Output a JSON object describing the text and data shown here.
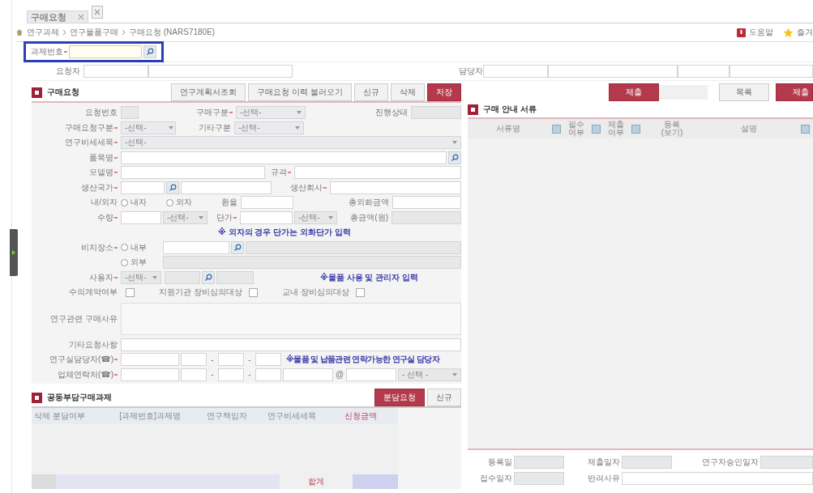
{
  "tabs": [
    {
      "label": "구매요청",
      "selected": true
    }
  ],
  "breadcrumb": [
    "연구과제",
    "연구물품구매",
    "구매요청 (NARS7180E)"
  ],
  "header_links": [
    {
      "label": "도움말",
      "kind": "help"
    },
    {
      "label": "즐겨",
      "kind": "favorite"
    }
  ],
  "project_no": {
    "label": "과제번호",
    "required": true,
    "highlighted": true
  },
  "requester": {
    "label": "요청자"
  },
  "manager": {
    "label": "담당자"
  },
  "request_section": {
    "title": "구매요청",
    "buttons": [
      {
        "label": "연구계획서조회",
        "kind": "normal"
      },
      {
        "label": "구매요청 이력 불러오기",
        "kind": "normal"
      },
      {
        "label": "신규",
        "kind": "normal"
      },
      {
        "label": "삭제",
        "kind": "normal"
      },
      {
        "label": "저장",
        "kind": "primary"
      }
    ]
  },
  "form": {
    "request_no": {
      "label": "요청번호"
    },
    "purchase_type": {
      "label": "구매구분",
      "required": true,
      "value": "-선택-"
    },
    "status": {
      "label": "진행상태"
    },
    "request_type": {
      "label": "구매요청구분",
      "required": true,
      "value": "-선택-"
    },
    "other_type": {
      "label": "기타구분",
      "value": "-선택-"
    },
    "budget_item": {
      "label": "연구비세세목",
      "required": true,
      "value": "-선택-"
    },
    "item_name": {
      "label": "품목명",
      "required": true
    },
    "model": {
      "label": "모델명",
      "required": true
    },
    "spec": {
      "label": "규격",
      "required": true
    },
    "country": {
      "label": "생산국가",
      "required": true
    },
    "maker": {
      "label": "생산회사",
      "required": true
    },
    "currency": {
      "label": "내/외자",
      "options": [
        {
          "label": "내자",
          "selected": false
        },
        {
          "label": "외자",
          "selected": false
        }
      ]
    },
    "exchange_rate": {
      "label": "환율"
    },
    "foreign_total": {
      "label": "총외화금액"
    },
    "quantity": {
      "label": "수량",
      "required": true,
      "unit": "-선택-"
    },
    "unit_price": {
      "label": "단가",
      "required": true,
      "unit": "-선택-"
    },
    "total_won": {
      "label": "총금액(원)"
    },
    "currency_note": "※ 외자의 경우 단가는 외화단가 입력",
    "location": {
      "label": "비치장소",
      "required": true,
      "options": [
        {
          "label": "내부",
          "selected": false
        },
        {
          "label": "외부",
          "selected": false
        }
      ]
    },
    "user": {
      "label": "사용자",
      "required": true,
      "value": "-선택-"
    },
    "user_note": "※물품 사용 및 관리자 입력",
    "checks": [
      {
        "label": "수의계약여부",
        "checked": false
      },
      {
        "label": "지원기관 장비심의대상",
        "checked": false
      },
      {
        "label": "교내 장비심의대상",
        "checked": false
      }
    ],
    "reason": {
      "label": "연구관련 구매사유"
    },
    "other_request": {
      "label": "기타요청사항"
    },
    "lab_contact": {
      "label": "연구실담당자(☎)",
      "required": true,
      "separators": [
        "-",
        "-"
      ],
      "note": "※물품 및 납품관련 연락가능한 연구실 담당자"
    },
    "vendor_contact": {
      "label": "업체연락처(☎)",
      "required": true,
      "separators": [
        "-",
        "-"
      ],
      "at": "@",
      "domain": "- 선택 -"
    }
  },
  "shared": {
    "title": "공동부담구매과제",
    "buttons": [
      {
        "label": "분담요청",
        "kind": "primary"
      },
      {
        "label": "신규",
        "kind": "normal"
      }
    ],
    "columns": [
      {
        "label": "삭제",
        "emphasis": false
      },
      {
        "label": "분담여부",
        "emphasis": false
      },
      {
        "label": "[과제번호]과제명",
        "emphasis": false
      },
      {
        "label": "연구책임자",
        "emphasis": false
      },
      {
        "label": "연구비세세목",
        "emphasis": false
      },
      {
        "label": "신청금액",
        "emphasis": true
      }
    ],
    "total_label": "합계"
  },
  "right_buttons": [
    {
      "label": "제출",
      "kind": "primary"
    },
    {
      "label": "목록",
      "kind": "normal"
    },
    {
      "label": "제출",
      "kind": "primary"
    }
  ],
  "documents": {
    "title": "구매 안내 서류",
    "columns": [
      {
        "label": "서류명",
        "checkbox": true
      },
      {
        "label": "필수\n여부",
        "checkbox": true
      },
      {
        "label": "제출\n여부",
        "checkbox": true
      },
      {
        "label": "등록\n(보기)",
        "checkbox": false
      },
      {
        "label": "설명",
        "checkbox": true
      }
    ]
  },
  "dates": [
    {
      "label": "등록일"
    },
    {
      "label": "제출일자"
    },
    {
      "label": "연구자승인일자"
    },
    {
      "label": "접수일자"
    },
    {
      "label": "반려사유"
    }
  ]
}
